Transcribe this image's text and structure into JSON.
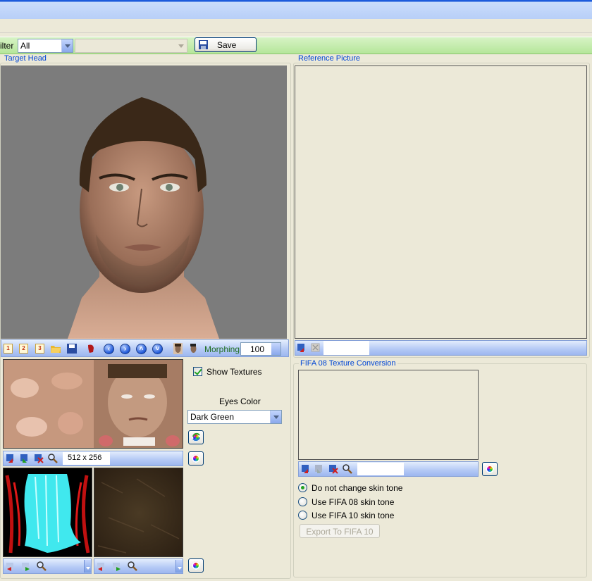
{
  "toolbar": {
    "filter_label": "ilter",
    "filter_value": "All",
    "second_combo_value": "",
    "save_label": "Save"
  },
  "target_head": {
    "title": "Target Head",
    "morphing_label": "Morphing",
    "morphing_value": "100",
    "show_textures_label": "Show Textures",
    "show_textures_checked": true,
    "eyes_color_label": "Eyes Color",
    "eyes_color_value": "Dark Green",
    "texture_size": "512 x 256"
  },
  "reference_picture": {
    "title": "Reference Picture"
  },
  "fifa08_conversion": {
    "title": "FIFA 08 Texture Conversion",
    "options": [
      {
        "label": "Do not change skin tone",
        "selected": true
      },
      {
        "label": "Use FIFA 08 skin tone",
        "selected": false
      },
      {
        "label": "Use FIFA 10 skin tone",
        "selected": false
      }
    ],
    "export_label": "Export To FIFA 10"
  },
  "colors": {
    "toolstrip_green": "#b5e69a",
    "viewport_bg": "#7c7c7c",
    "group_title": "#0046d5",
    "morphing_label": "#1f6e1f"
  }
}
